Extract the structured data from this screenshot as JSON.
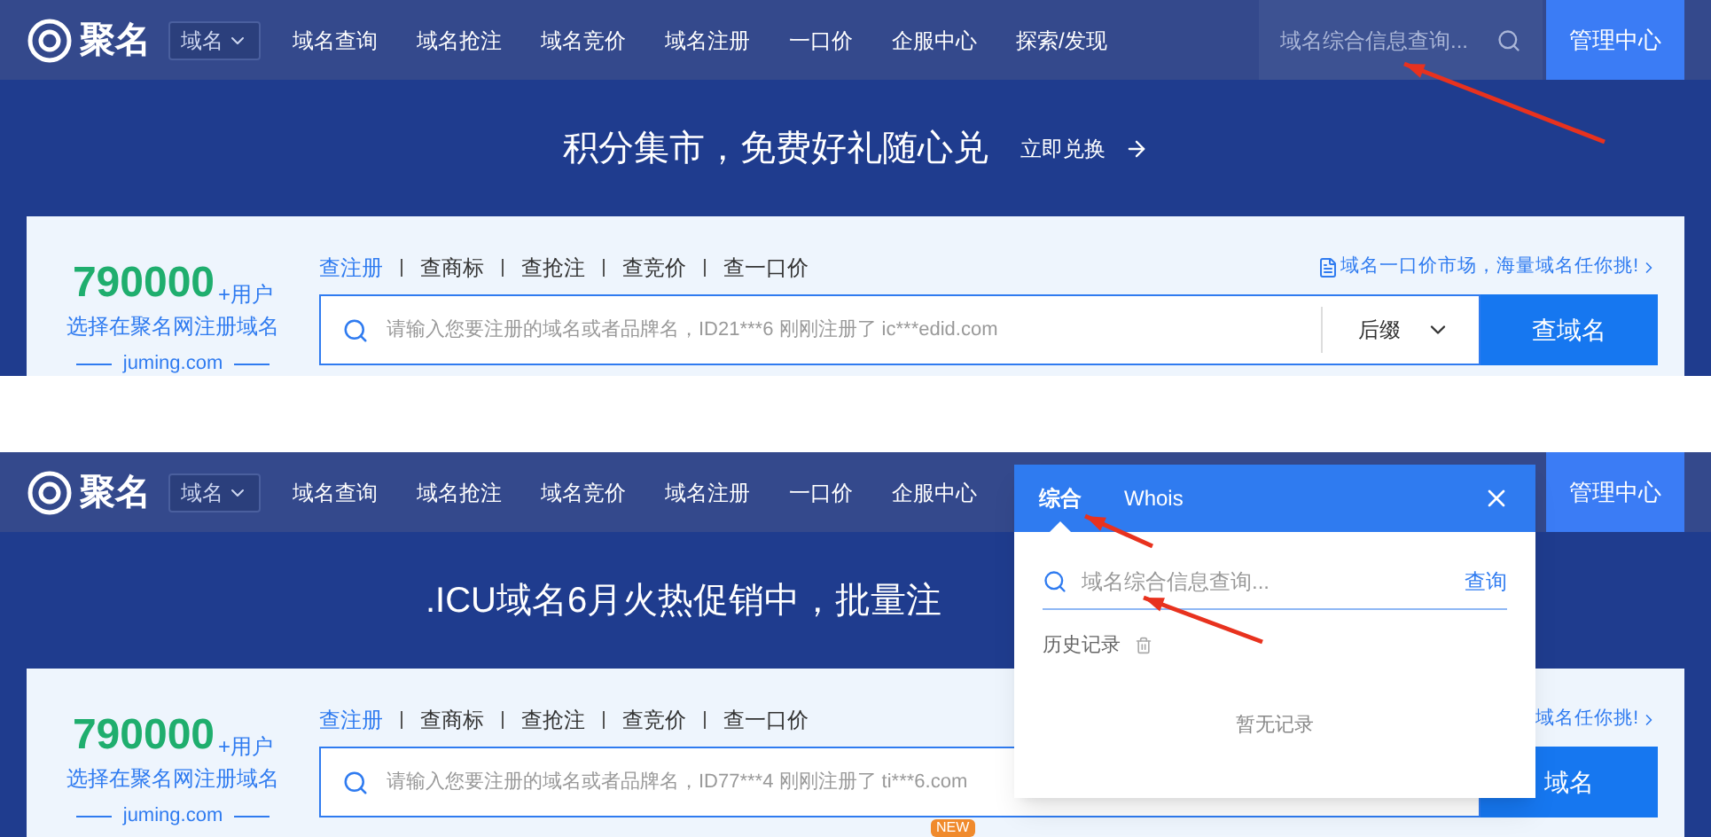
{
  "screenshots": [
    {
      "kind": "plain",
      "nav": {
        "logo": "聚名",
        "category": "域名",
        "items": [
          "域名查询",
          "域名抢注",
          "域名竞价",
          "域名注册",
          "一口价",
          "企服中心",
          "探索/发现"
        ],
        "search_placeholder": "域名综合信息查询...",
        "manage_button": "管理中心"
      },
      "banner": {
        "title": "积分集市，免费好礼随心兑",
        "link": "立即兑换"
      },
      "card": {
        "user_count": "790000",
        "user_suffix": "+用户",
        "tagline": "选择在聚名网注册域名",
        "site": "juming.com",
        "tabs": [
          {
            "label": "查注册",
            "selected": true
          },
          {
            "label": "查商标",
            "selected": false
          },
          {
            "label": "查抢注",
            "selected": false
          },
          {
            "label": "查竞价",
            "selected": false
          },
          {
            "label": "查一口价",
            "selected": false
          }
        ],
        "promo": "域名一口价市场，海量域名任你挑!",
        "placeholder": "请输入您要注册的域名或者品牌名，ID21***6 刚刚注册了 ic***edid.com",
        "suffix": "后缀",
        "button": "查域名"
      }
    },
    {
      "kind": "popup",
      "nav": {
        "logo": "聚名",
        "category": "域名",
        "items": [
          "域名查询",
          "域名抢注",
          "域名竞价",
          "域名注册",
          "一口价",
          "企服中心"
        ],
        "manage_button": "管理中心"
      },
      "banner": {
        "title": ".ICU域名6月火热促销中，批量注"
      },
      "card": {
        "user_count": "790000",
        "user_suffix": "+用户",
        "tagline": "选择在聚名网注册域名",
        "site": "juming.com",
        "tabs": [
          {
            "label": "查注册",
            "selected": true
          },
          {
            "label": "查商标",
            "selected": false
          },
          {
            "label": "查抢注",
            "selected": false
          },
          {
            "label": "查竞价",
            "selected": false
          },
          {
            "label": "查一口价",
            "selected": false
          }
        ],
        "promo": "域名任你挑!",
        "placeholder": "请输入您要注册的域名或者品牌名，ID77***4 刚刚注册了 ti***6.com",
        "button": "域名",
        "badge": "NEW"
      },
      "popup": {
        "tabs": [
          {
            "label": "综合",
            "selected": true
          },
          {
            "label": "Whois",
            "selected": false
          }
        ],
        "placeholder": "域名综合信息查询...",
        "query_button": "查询",
        "history_label": "历史记录",
        "empty_text": "暂无记录"
      }
    }
  ]
}
